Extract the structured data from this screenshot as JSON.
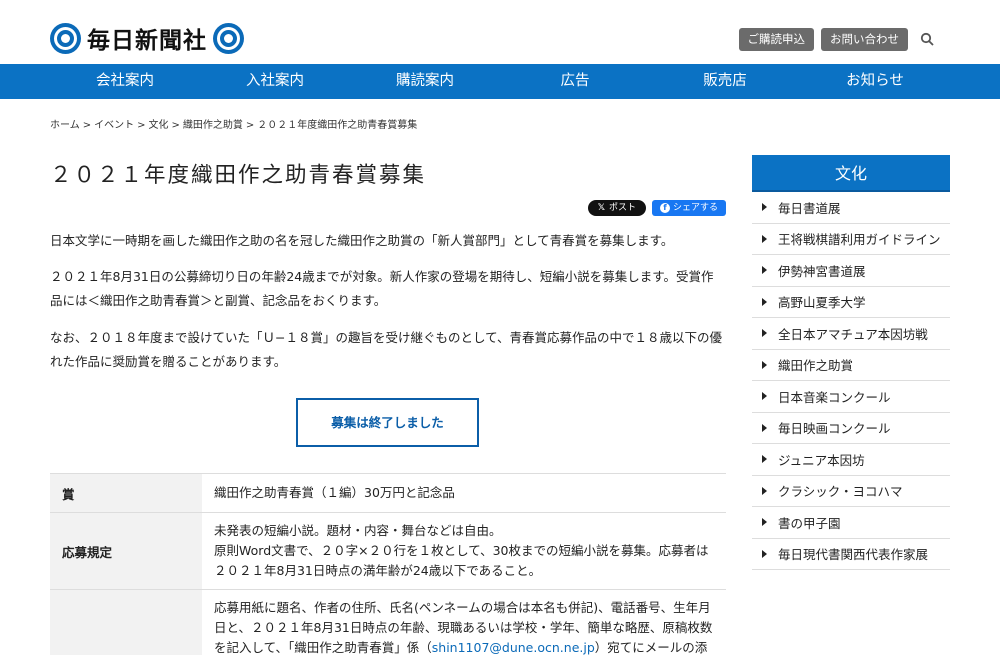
{
  "header": {
    "logo_text": "毎日新聞社",
    "buttons": [
      "ご購読申込",
      "お問い合わせ"
    ]
  },
  "nav": [
    "会社案内",
    "入社案内",
    "購読案内",
    "広告",
    "販売店",
    "お知らせ"
  ],
  "breadcrumb": [
    "ホーム",
    "イベント",
    "文化",
    "織田作之助賞",
    "２０２１年度織田作之助青春賞募集"
  ],
  "main": {
    "title": "２０２１年度織田作之助青春賞募集",
    "share": {
      "x_label": "ポスト",
      "x_glyph": "𝕏",
      "fb_label": "シェアする"
    },
    "paragraphs": [
      "日本文学に一時期を画した織田作之助の名を冠した織田作之助賞の「新人賞部門」として青春賞を募集します。",
      "２０２１年8月31日の公募締切り日の年齢24歳までが対象。新人作家の登場を期待し、短編小説を募集します。受賞作品には＜織田作之助青春賞＞と副賞、記念品をおくります。",
      "なお、２０１８年度まで設けていた「Ｕ−１８賞」の趣旨を受け継ぐものとして、青春賞応募作品の中で１８歳以下の優れた作品に奨励賞を贈ることがあります。"
    ],
    "closed_button": "募集は終了しました",
    "table": [
      {
        "label": "賞",
        "lines": [
          "織田作之助青春賞（１編）30万円と記念品"
        ]
      },
      {
        "label": "応募規定",
        "lines": [
          "未発表の短編小説。題材・内容・舞台などは自由。",
          "原則Word文書で、２０字×２０行を１枚として、30枚までの短編小説を募集。応募者は２０２１年8月31日時点の満年齢が24歳以下であること。"
        ]
      },
      {
        "label": "",
        "text_before": "応募用紙に題名、作者の住所、氏名(ペンネームの場合は本名も併記)、電話番号、生年月日と、２０２１年8月31日時点の年齢、現職あるいは学校・学年、簡単な略歴、原稿枚数を記入して、「織田作之助青春賞」係（",
        "email": "shin1107@dune.ocn.ne.jp",
        "text_after": "）宛てにメールの添付ファイルで送信してください。"
      }
    ]
  },
  "sidebar": {
    "heading": "文化",
    "items": [
      "毎日書道展",
      "王将戦棋譜利用ガイドライン",
      "伊勢神宮書道展",
      "高野山夏季大学",
      "全日本アマチュア本因坊戦",
      "織田作之助賞",
      "日本音楽コンクール",
      "毎日映画コンクール",
      "ジュニア本因坊",
      "クラシック・ヨコハマ",
      "書の甲子園",
      "毎日現代書関西代表作家展"
    ]
  },
  "colors": {
    "brand_blue": "#0b72c4",
    "button_gray": "#6b6b6b"
  }
}
